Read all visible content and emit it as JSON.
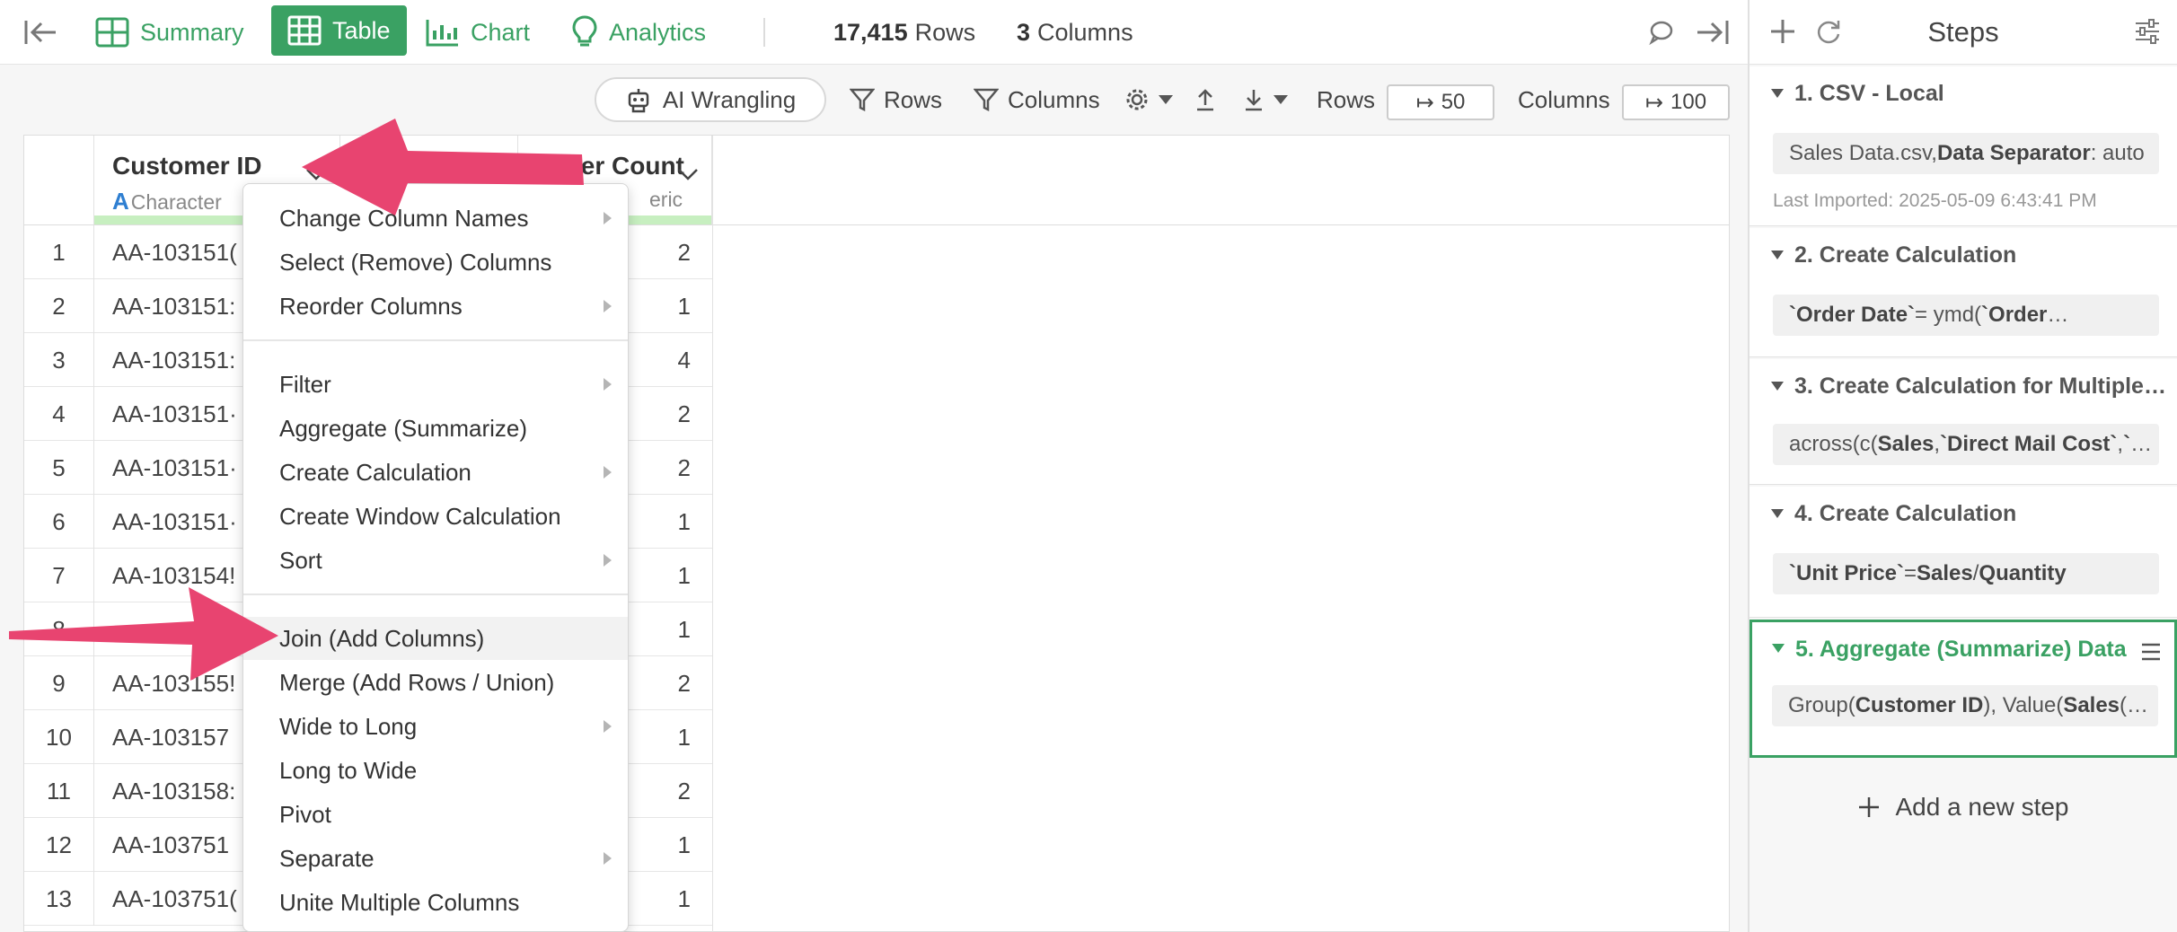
{
  "topbar": {
    "tabs": [
      {
        "label": "Summary",
        "icon": "summary-grid-icon"
      },
      {
        "label": "Table",
        "icon": "table-icon"
      },
      {
        "label": "Chart",
        "icon": "chart-icon"
      },
      {
        "label": "Analytics",
        "icon": "lightbulb-icon"
      }
    ],
    "rows_count": "17,415",
    "rows_label": "Rows",
    "cols_count": "3",
    "cols_label": "Columns"
  },
  "toolbar": {
    "ai_label": "AI Wrangling",
    "filter_rows": "Rows",
    "filter_cols": "Columns",
    "rows_label": "Rows",
    "rows_value": "50",
    "cols_label": "Columns",
    "cols_value": "100"
  },
  "table": {
    "columns": [
      {
        "name": "Customer ID",
        "type": "Character",
        "type_letter": "A"
      },
      {
        "name": "Order Count",
        "type": "eric"
      }
    ],
    "rows": [
      {
        "n": "1",
        "id": "AA-103151(",
        "count": "2"
      },
      {
        "n": "2",
        "id": "AA-103151:",
        "count": "1"
      },
      {
        "n": "3",
        "id": "AA-103151:",
        "count": "4"
      },
      {
        "n": "4",
        "id": "AA-103151·",
        "count": "2"
      },
      {
        "n": "5",
        "id": "AA-103151·",
        "count": "2"
      },
      {
        "n": "6",
        "id": "AA-103151·",
        "count": "1"
      },
      {
        "n": "7",
        "id": "AA-103154!",
        "count": "1"
      },
      {
        "n": "8",
        "id": "",
        "count": "1"
      },
      {
        "n": "9",
        "id": "AA-103155!",
        "count": "2"
      },
      {
        "n": "10",
        "id": "AA-103157",
        "count": "1"
      },
      {
        "n": "11",
        "id": "AA-103158:",
        "count": "2"
      },
      {
        "n": "12",
        "id": "AA-103751",
        "count": "1"
      },
      {
        "n": "13",
        "id": "AA-103751(",
        "count": "1"
      }
    ]
  },
  "menu": {
    "groups": [
      [
        {
          "label": "Change Column Names",
          "sub": true
        },
        {
          "label": "Select (Remove) Columns",
          "sub": false
        },
        {
          "label": "Reorder Columns",
          "sub": true
        }
      ],
      [
        {
          "label": "Filter",
          "sub": true
        },
        {
          "label": "Aggregate (Summarize)",
          "sub": false
        },
        {
          "label": "Create Calculation",
          "sub": true
        },
        {
          "label": "Create Window Calculation",
          "sub": false
        },
        {
          "label": "Sort",
          "sub": true
        }
      ],
      [
        {
          "label": "Join (Add Columns)",
          "sub": false,
          "highlighted": true
        },
        {
          "label": "Merge (Add Rows / Union)",
          "sub": false
        },
        {
          "label": "Wide to Long",
          "sub": true
        },
        {
          "label": "Long to Wide",
          "sub": false
        },
        {
          "label": "Pivot",
          "sub": false
        },
        {
          "label": "Separate",
          "sub": true
        },
        {
          "label": "Unite Multiple Columns",
          "sub": false
        }
      ]
    ]
  },
  "sidebar": {
    "title": "Steps",
    "steps": [
      {
        "title": "1. CSV - Local",
        "body_html": "Sales Data.csv, <b>Data Separator</b>: auto",
        "meta": "Last Imported: 2025-05-09 6:43:41 PM"
      },
      {
        "title": "2. Create Calculation",
        "body_html": "<b>`Order Date`</b> = ymd(<b>`Order</b> …"
      },
      {
        "title": "3. Create Calculation for Multiple…",
        "body_html": "across(c(<b>Sales</b>, <b>`Direct Mail Cost`</b>, <b>`</b>…"
      },
      {
        "title": "4. Create Calculation",
        "body_html": "<b>`Unit Price`</b> = <b>Sales</b> / <b>Quantity</b>"
      },
      {
        "title": "5. Aggregate (Summarize) Data",
        "body_html": "Group(<b>Customer ID</b>), Value(<b>Sales</b> (…",
        "active": true
      }
    ],
    "add_step": "Add a new step"
  },
  "colors": {
    "accent": "#3aa163",
    "arrow": "#e84470",
    "header_bar": "#c7efc0"
  }
}
